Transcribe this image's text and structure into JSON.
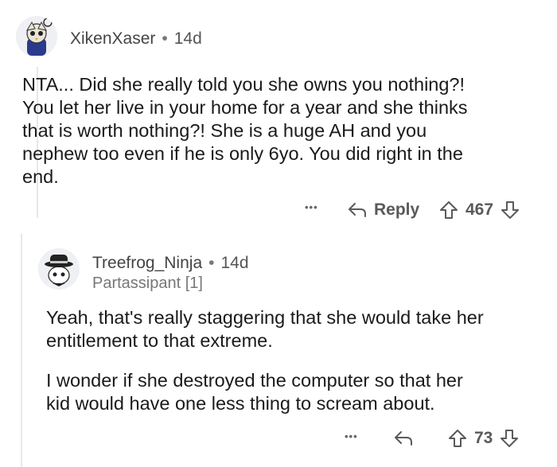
{
  "comments": [
    {
      "username": "XikenXaser",
      "separator": "•",
      "age": "14d",
      "body": [
        "NTA... Did she really told you she owns you nothing?!",
        "You let her live in your home for a year and she thinks",
        "that is worth nothing?! She is a huge AH and you",
        "nephew too even if he is only 6yo. You did right in the",
        "end."
      ],
      "more": "•••",
      "reply_label": "Reply",
      "score": "467"
    },
    {
      "username": "Treefrog_Ninja",
      "separator": "•",
      "age": "14d",
      "flair": "Partassipant [1]",
      "body_paragraphs": [
        [
          "Yeah, that's really staggering that she would take her",
          "entitlement to that extreme."
        ],
        [
          "I wonder if she destroyed the computer so that her",
          "kid would have one less thing to scream about."
        ]
      ],
      "more": "•••",
      "score": "73"
    }
  ],
  "icons": [
    "avatar-xikenxaser",
    "avatar-treefrog-ninja",
    "more-icon",
    "reply-arrow-icon",
    "upvote-icon",
    "downvote-icon"
  ]
}
